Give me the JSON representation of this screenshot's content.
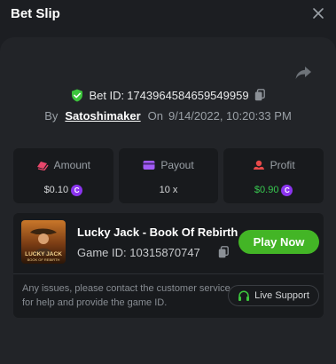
{
  "header": {
    "title": "Bet Slip",
    "close_icon": "close-icon"
  },
  "bet": {
    "bet_id_label": "Bet ID:",
    "bet_id": "1743964584659549959",
    "by_label": "By",
    "username": "Satoshimaker",
    "on_label": "On",
    "datetime": "9/14/2022, 10:20:33 PM"
  },
  "stats": {
    "amount": {
      "label": "Amount",
      "value": "$0.10",
      "icon": "coins-icon",
      "color": "#e8476b"
    },
    "payout": {
      "label": "Payout",
      "value": "10 x",
      "icon": "card-icon",
      "color": "#a25bf5"
    },
    "profit": {
      "label": "Profit",
      "value": "$0.90",
      "icon": "profit-icon",
      "color": "#e84a4a"
    }
  },
  "game": {
    "name": "Lucky Jack - Book Of Rebirth",
    "id_label": "Game ID:",
    "id": "10315870747",
    "play_label": "Play Now",
    "thumbnail_title_line1": "LUCKY JACK",
    "thumbnail_title_line2": "BOOK OF REBIRTH"
  },
  "support": {
    "notice": "Any issues, please contact the customer service for help and provide the game ID.",
    "button_label": "Live Support",
    "icon": "headset-icon"
  },
  "colors": {
    "accent_green": "#43b526",
    "profit_green": "#38c950",
    "coin_purple": "#8b34ef",
    "shield_green": "#3cc43c"
  }
}
